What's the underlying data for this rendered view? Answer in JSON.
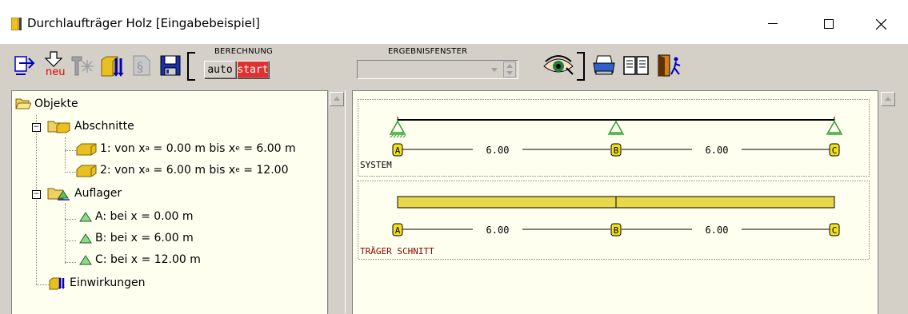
{
  "window": {
    "title": "Durchlaufträger Holz [Eingabebeispiel]",
    "controls": {
      "minimize": "—",
      "maximize": "☐",
      "close": "✕"
    }
  },
  "toolbar": {
    "new_label": "neu",
    "berechnung_label": "BERECHNUNG",
    "auto_label": "auto",
    "start_label": "start",
    "ergebnisfenster_label": "ERGEBNISFENSTER",
    "ergebnisfenster_value": ""
  },
  "tree": {
    "root": "Objekte",
    "abschnitte": {
      "label": "Abschnitte",
      "items": [
        {
          "prefix": "1: von x",
          "sub_a": "a",
          "mid": " = 0.00 m bis x",
          "sub_e": "e",
          "suffix": " = 6.00 m"
        },
        {
          "prefix": "2: von x",
          "sub_a": "a",
          "mid": " = 6.00 m bis x",
          "sub_e": "e",
          "suffix": " = 12.00"
        }
      ]
    },
    "auflager": {
      "label": "Auflager",
      "items": [
        "A: bei x = 0.00 m",
        "B: bei x = 6.00 m",
        "C: bei x = 12.00 m"
      ]
    },
    "einwirkungen": "Einwirkungen"
  },
  "graphics": {
    "system": {
      "label": "SYSTEM",
      "supports": [
        "A",
        "B",
        "C"
      ],
      "spans": [
        "6.00",
        "6.00"
      ]
    },
    "section": {
      "label": "TRÄGER SCHNITT",
      "supports": [
        "A",
        "B",
        "C"
      ],
      "spans": [
        "6.00",
        "6.00"
      ]
    },
    "colors": {
      "beam_fill": "#e8d84a",
      "label_red": "#8b0000",
      "support_green": "#2e9e2e"
    }
  }
}
